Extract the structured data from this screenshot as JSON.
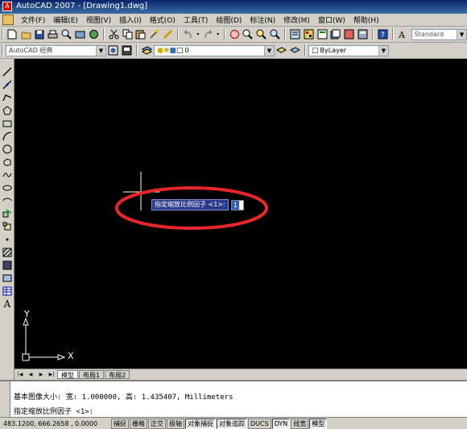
{
  "window": {
    "title": "AutoCAD 2007 - [Drawing1.dwg]"
  },
  "menu": [
    "文件(F)",
    "编辑(E)",
    "视图(V)",
    "插入(I)",
    "格式(O)",
    "工具(T)",
    "绘图(D)",
    "标注(N)",
    "修改(M)",
    "窗口(W)",
    "帮助(H)"
  ],
  "toolbar": {
    "text_style": "Standard",
    "workspace": "AutoCAD 经典",
    "layer": "0",
    "color": "ByLayer"
  },
  "prompt": {
    "text": "指定缩放比例因子 <1>:",
    "value": "1"
  },
  "axes": {
    "x": "X",
    "y": "Y"
  },
  "tabs": [
    "模型",
    "布局1",
    "布局2"
  ],
  "command": {
    "line1": "基本图像大小: 宽: 1.000000, 高: 1.435407, Millimeters",
    "line2": "指定缩放比例因子 <1>:"
  },
  "status": {
    "coords": "483.1200, 666.2658 , 0.0000",
    "buttons": [
      "捕捉",
      "栅格",
      "正交",
      "极轴",
      "对象捕捉",
      "对象追踪",
      "DUCS",
      "DYN",
      "线宽",
      "模型"
    ]
  },
  "colors": {
    "highlight": "#e8262c",
    "prompt_bg": "#2b3a8c",
    "canvas": "#000000"
  }
}
